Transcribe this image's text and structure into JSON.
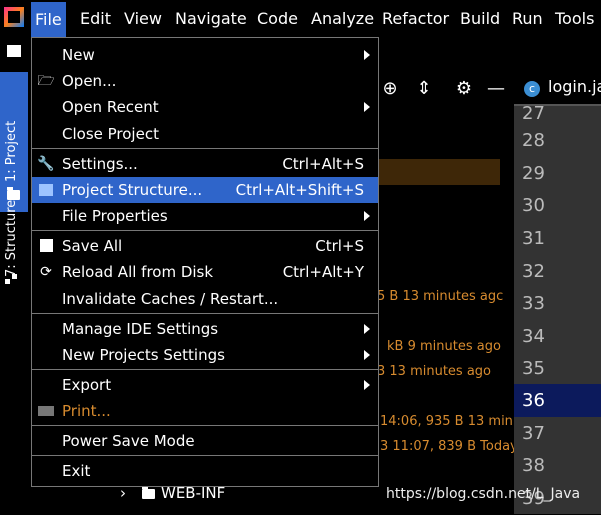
{
  "menubar": {
    "items": [
      "File",
      "Edit",
      "View",
      "Navigate",
      "Code",
      "Analyze",
      "Refactor",
      "Build",
      "Run",
      "Tools"
    ]
  },
  "toolwindows": {
    "project": "1: Project",
    "structure": "7: Structure"
  },
  "editor": {
    "tab": "login.ja",
    "lines": [
      "27",
      "28",
      "29",
      "30",
      "31",
      "32",
      "33",
      "34",
      "35",
      "36",
      "37",
      "38",
      "39"
    ],
    "current_line": "36"
  },
  "file_menu": {
    "items": [
      {
        "label": "New",
        "shortcut": "",
        "submenu": true
      },
      {
        "label": "Open...",
        "shortcut": "",
        "icon": "folder-open-icon"
      },
      {
        "label": "Open Recent",
        "shortcut": "",
        "submenu": true
      },
      {
        "label": "Close Project",
        "shortcut": ""
      },
      {
        "label": "Settings...",
        "shortcut": "Ctrl+Alt+S",
        "icon": "wrench-icon"
      },
      {
        "label": "Project Structure...",
        "shortcut": "Ctrl+Alt+Shift+S",
        "icon": "project-structure-icon",
        "selected": true
      },
      {
        "label": "File Properties",
        "shortcut": "",
        "submenu": true
      },
      {
        "label": "Save All",
        "shortcut": "Ctrl+S",
        "icon": "save-icon"
      },
      {
        "label": "Reload All from Disk",
        "shortcut": "Ctrl+Alt+Y",
        "icon": "reload-icon"
      },
      {
        "label": "Invalidate Caches / Restart...",
        "shortcut": ""
      },
      {
        "label": "Manage IDE Settings",
        "shortcut": "",
        "submenu": true
      },
      {
        "label": "New Projects Settings",
        "shortcut": "",
        "submenu": true
      },
      {
        "label": "Export",
        "shortcut": "",
        "submenu": true
      },
      {
        "label": "Print...",
        "shortcut": "",
        "icon": "print-icon"
      },
      {
        "label": "Power Save Mode",
        "shortcut": ""
      },
      {
        "label": "Exit",
        "shortcut": ""
      }
    ]
  },
  "project_tree": {
    "timestamps": [
      "5 B 13 minutes agc",
      "kB 9 minutes ago",
      "3 13 minutes ago",
      "14:06, 935 B 13 min",
      "3 11:07, 839 B Today"
    ],
    "folder": "WEB-INF"
  },
  "watermark": "https://blog.csdn.net/L_Java"
}
